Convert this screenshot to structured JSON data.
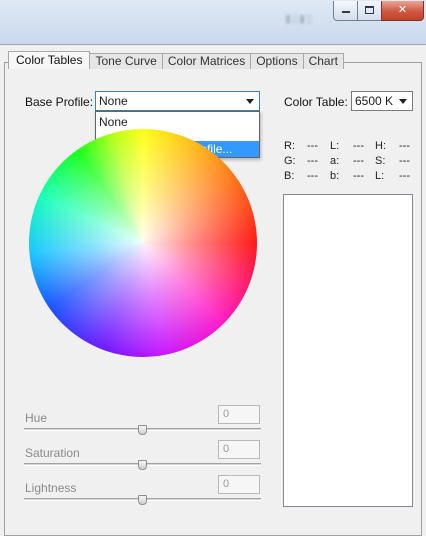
{
  "tabs": [
    {
      "label": "Color Tables"
    },
    {
      "label": "Tone Curve"
    },
    {
      "label": "Color Matrices"
    },
    {
      "label": "Options"
    },
    {
      "label": "Chart"
    }
  ],
  "base_profile": {
    "label": "Base Profile:",
    "value": "None",
    "options": [
      "None",
      "Choose external profile..."
    ]
  },
  "color_table": {
    "label": "Color Table:",
    "value": "6500 K"
  },
  "readouts": [
    {
      "name": "R:",
      "value": "---"
    },
    {
      "name": "G:",
      "value": "---"
    },
    {
      "name": "B:",
      "value": "---"
    },
    {
      "name": "L:",
      "value": "---"
    },
    {
      "name": "a:",
      "value": "---"
    },
    {
      "name": "b:",
      "value": "---"
    },
    {
      "name": "H:",
      "value": "---"
    },
    {
      "name": "S:",
      "value": "---"
    },
    {
      "name": "L:",
      "value": "---"
    }
  ],
  "sliders": [
    {
      "label": "Hue",
      "value": "0"
    },
    {
      "label": "Saturation",
      "value": "0"
    },
    {
      "label": "Lightness",
      "value": "0"
    }
  ],
  "colors": {
    "selection": "#3399ff",
    "window_bg": "#f0f0f0",
    "close_button": "#c1402a"
  }
}
